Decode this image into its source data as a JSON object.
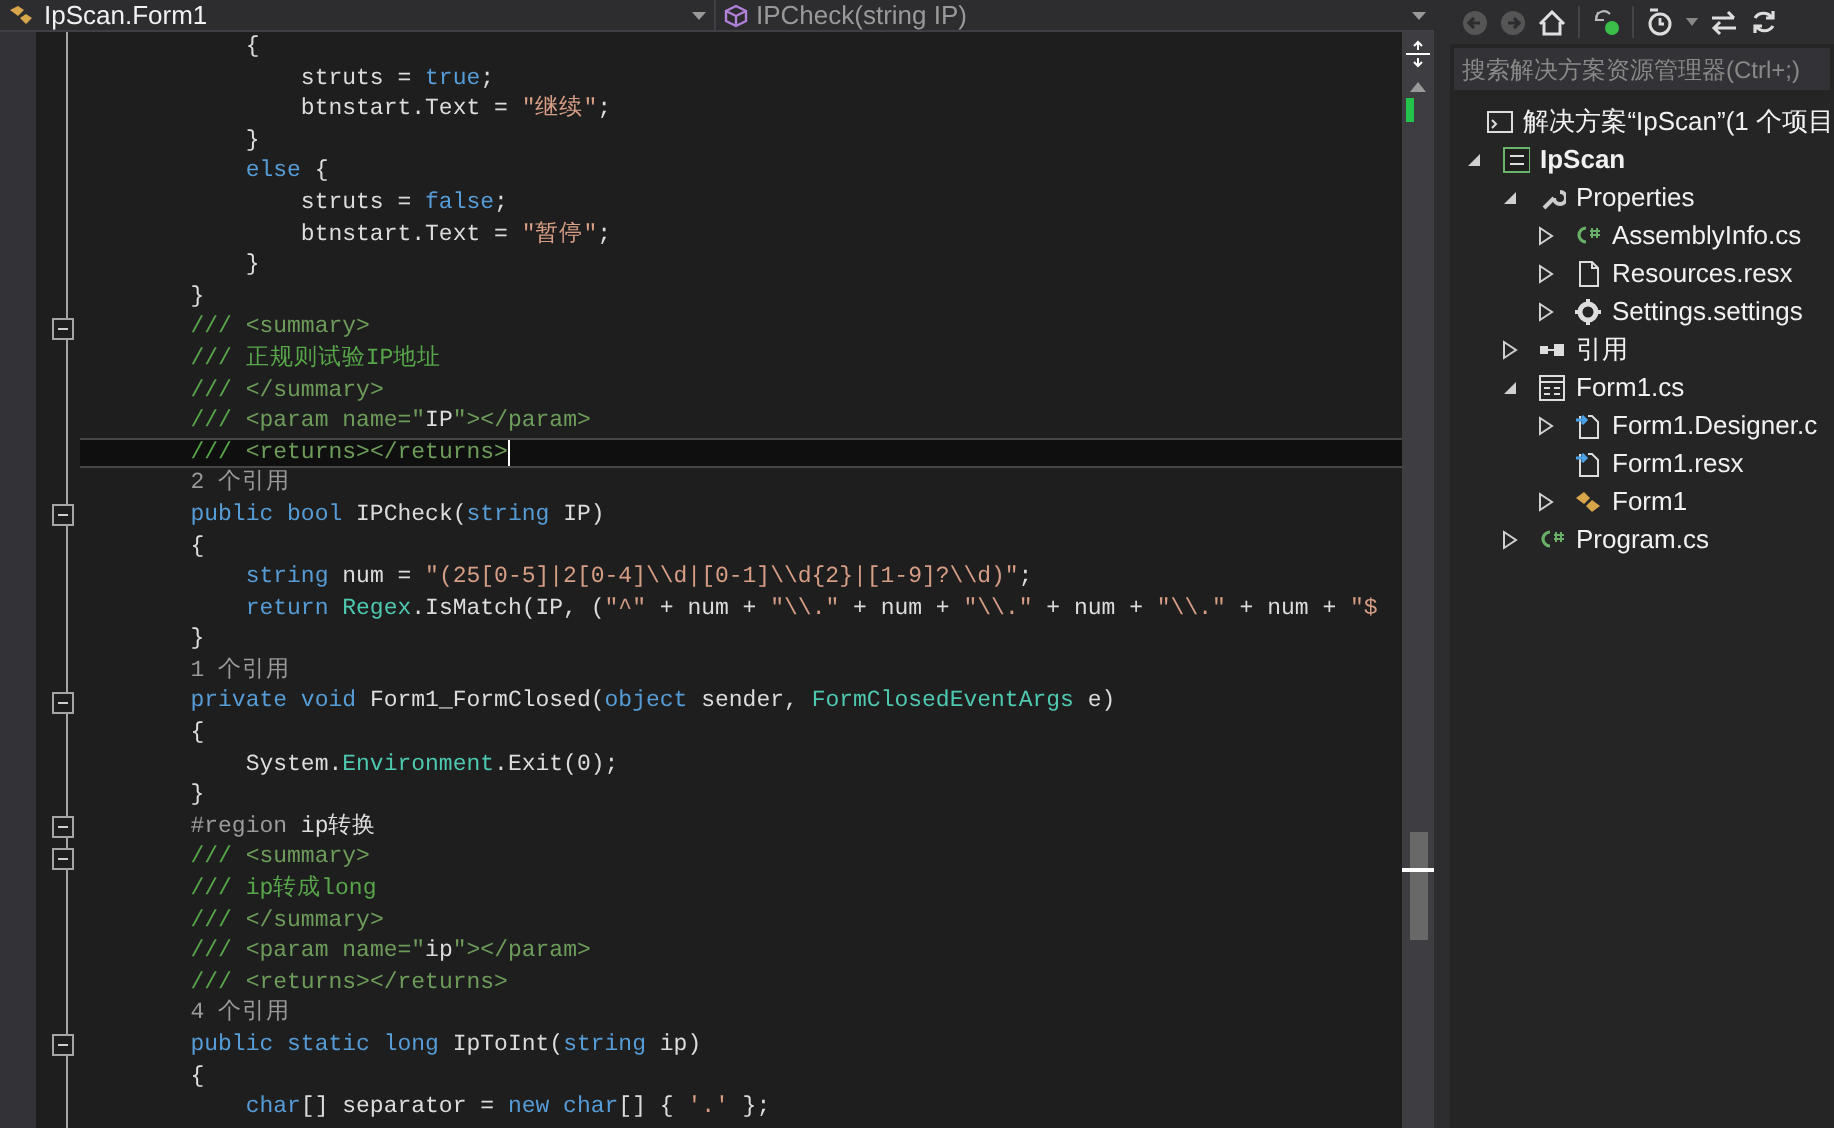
{
  "nav_bar": {
    "type_dropdown": "IpScan.Form1",
    "member_dropdown": "IPCheck(string IP)"
  },
  "code_lines": [
    {
      "fold": false,
      "current": false,
      "spans": [
        {
          "kind": "p",
          "text": "            {"
        }
      ]
    },
    {
      "fold": false,
      "current": false,
      "spans": [
        {
          "kind": "p",
          "text": "                struts = "
        },
        {
          "kind": "kw",
          "text": "true"
        },
        {
          "kind": "p",
          "text": ";"
        }
      ]
    },
    {
      "fold": false,
      "current": false,
      "spans": [
        {
          "kind": "p",
          "text": "                btnstart.Text = "
        },
        {
          "kind": "str",
          "text": "\"继续\""
        },
        {
          "kind": "p",
          "text": ";"
        }
      ]
    },
    {
      "fold": false,
      "current": false,
      "spans": [
        {
          "kind": "p",
          "text": "            }"
        }
      ]
    },
    {
      "fold": false,
      "current": false,
      "spans": [
        {
          "kind": "kw",
          "text": "            else"
        },
        {
          "kind": "p",
          "text": " {"
        }
      ]
    },
    {
      "fold": false,
      "current": false,
      "spans": [
        {
          "kind": "p",
          "text": "                struts = "
        },
        {
          "kind": "kw",
          "text": "false"
        },
        {
          "kind": "p",
          "text": ";"
        }
      ]
    },
    {
      "fold": false,
      "current": false,
      "spans": [
        {
          "kind": "p",
          "text": "                btnstart.Text = "
        },
        {
          "kind": "str",
          "text": "\"暂停\""
        },
        {
          "kind": "p",
          "text": ";"
        }
      ]
    },
    {
      "fold": false,
      "current": false,
      "spans": [
        {
          "kind": "p",
          "text": "            }"
        }
      ]
    },
    {
      "fold": false,
      "current": false,
      "spans": [
        {
          "kind": "p",
          "text": "        }"
        }
      ]
    },
    {
      "fold": true,
      "current": false,
      "spans": [
        {
          "kind": "cm",
          "text": "        /// "
        },
        {
          "kind": "doc",
          "text": "<summary>"
        }
      ]
    },
    {
      "fold": false,
      "current": false,
      "spans": [
        {
          "kind": "cm",
          "text": "        /// 正规则试验IP地址"
        }
      ]
    },
    {
      "fold": false,
      "current": false,
      "spans": [
        {
          "kind": "cm",
          "text": "        /// "
        },
        {
          "kind": "doc",
          "text": "</summary>"
        }
      ]
    },
    {
      "fold": false,
      "current": false,
      "spans": [
        {
          "kind": "cm",
          "text": "        /// "
        },
        {
          "kind": "doc",
          "text": "<param name=\""
        },
        {
          "kind": "p",
          "text": "IP"
        },
        {
          "kind": "doc",
          "text": "\"></param>"
        }
      ]
    },
    {
      "fold": false,
      "current": true,
      "spans": [
        {
          "kind": "cm",
          "text": "        /// "
        },
        {
          "kind": "doc",
          "text": "<returns></returns>"
        }
      ]
    },
    {
      "fold": false,
      "current": false,
      "spans": [
        {
          "kind": "lens",
          "text": "        2 个引用"
        }
      ]
    },
    {
      "fold": true,
      "current": false,
      "spans": [
        {
          "kind": "kw",
          "text": "        public bool "
        },
        {
          "kind": "p",
          "text": "IPCheck("
        },
        {
          "kind": "kw",
          "text": "string"
        },
        {
          "kind": "p",
          "text": " IP)"
        }
      ]
    },
    {
      "fold": false,
      "current": false,
      "spans": [
        {
          "kind": "p",
          "text": "        {"
        }
      ]
    },
    {
      "fold": false,
      "current": false,
      "spans": [
        {
          "kind": "kw",
          "text": "            string"
        },
        {
          "kind": "p",
          "text": " num = "
        },
        {
          "kind": "str",
          "text": "\"(25[0-5]|2[0-4]\\\\d|[0-1]\\\\d{2}|[1-9]?\\\\d)\""
        },
        {
          "kind": "p",
          "text": ";"
        }
      ]
    },
    {
      "fold": false,
      "current": false,
      "spans": [
        {
          "kind": "kw",
          "text": "            return "
        },
        {
          "kind": "ty",
          "text": "Regex"
        },
        {
          "kind": "p",
          "text": ".IsMatch(IP, ("
        },
        {
          "kind": "str",
          "text": "\"^\""
        },
        {
          "kind": "p",
          "text": " + num + "
        },
        {
          "kind": "str",
          "text": "\"\\\\.\""
        },
        {
          "kind": "p",
          "text": " + num + "
        },
        {
          "kind": "str",
          "text": "\"\\\\.\""
        },
        {
          "kind": "p",
          "text": " + num + "
        },
        {
          "kind": "str",
          "text": "\"\\\\.\""
        },
        {
          "kind": "p",
          "text": " + num + "
        },
        {
          "kind": "str",
          "text": "\"$"
        }
      ]
    },
    {
      "fold": false,
      "current": false,
      "spans": [
        {
          "kind": "p",
          "text": "        }"
        }
      ]
    },
    {
      "fold": false,
      "current": false,
      "spans": [
        {
          "kind": "lens",
          "text": "        1 个引用"
        }
      ]
    },
    {
      "fold": true,
      "current": false,
      "spans": [
        {
          "kind": "kw",
          "text": "        private void "
        },
        {
          "kind": "p",
          "text": "Form1_FormClosed("
        },
        {
          "kind": "kw",
          "text": "object"
        },
        {
          "kind": "p",
          "text": " sender, "
        },
        {
          "kind": "ty",
          "text": "FormClosedEventArgs"
        },
        {
          "kind": "p",
          "text": " e)"
        }
      ]
    },
    {
      "fold": false,
      "current": false,
      "spans": [
        {
          "kind": "p",
          "text": "        {"
        }
      ]
    },
    {
      "fold": false,
      "current": false,
      "spans": [
        {
          "kind": "p",
          "text": "            System."
        },
        {
          "kind": "ty",
          "text": "Environment"
        },
        {
          "kind": "p",
          "text": ".Exit(0);"
        }
      ]
    },
    {
      "fold": false,
      "current": false,
      "spans": [
        {
          "kind": "p",
          "text": "        }"
        }
      ]
    },
    {
      "fold": true,
      "current": false,
      "spans": [
        {
          "kind": "pre",
          "text": "        #region "
        },
        {
          "kind": "p",
          "text": "ip转换"
        }
      ]
    },
    {
      "fold": true,
      "current": false,
      "spans": [
        {
          "kind": "cm",
          "text": "        /// "
        },
        {
          "kind": "doc",
          "text": "<summary>"
        }
      ]
    },
    {
      "fold": false,
      "current": false,
      "spans": [
        {
          "kind": "cm",
          "text": "        /// ip转成long"
        }
      ]
    },
    {
      "fold": false,
      "current": false,
      "spans": [
        {
          "kind": "cm",
          "text": "        /// "
        },
        {
          "kind": "doc",
          "text": "</summary>"
        }
      ]
    },
    {
      "fold": false,
      "current": false,
      "spans": [
        {
          "kind": "cm",
          "text": "        /// "
        },
        {
          "kind": "doc",
          "text": "<param name=\""
        },
        {
          "kind": "p",
          "text": "ip"
        },
        {
          "kind": "doc",
          "text": "\"></param>"
        }
      ]
    },
    {
      "fold": false,
      "current": false,
      "spans": [
        {
          "kind": "cm",
          "text": "        /// "
        },
        {
          "kind": "doc",
          "text": "<returns></returns>"
        }
      ]
    },
    {
      "fold": false,
      "current": false,
      "spans": [
        {
          "kind": "lens",
          "text": "        4 个引用"
        }
      ]
    },
    {
      "fold": true,
      "current": false,
      "spans": [
        {
          "kind": "kw",
          "text": "        public static long "
        },
        {
          "kind": "p",
          "text": "IpToInt("
        },
        {
          "kind": "kw",
          "text": "string"
        },
        {
          "kind": "p",
          "text": " ip)"
        }
      ]
    },
    {
      "fold": false,
      "current": false,
      "spans": [
        {
          "kind": "p",
          "text": "        {"
        }
      ]
    },
    {
      "fold": false,
      "current": false,
      "spans": [
        {
          "kind": "kw",
          "text": "            char"
        },
        {
          "kind": "p",
          "text": "[] separator = "
        },
        {
          "kind": "kw",
          "text": "new char"
        },
        {
          "kind": "p",
          "text": "[] { "
        },
        {
          "kind": "str",
          "text": "'.'"
        },
        {
          "kind": "p",
          "text": " };"
        }
      ]
    }
  ],
  "solution_explorer": {
    "search": {
      "placeholder": "搜索解决方案资源管理器(Ctrl+;)"
    },
    "tree": [
      {
        "label": "解决方案“IpScan”(1 个项目",
        "kind": "solution",
        "startup": false
      },
      {
        "label": "IpScan",
        "kind": "project",
        "expanded": true,
        "startup": true,
        "children": [
          {
            "label": "Properties",
            "kind": "wrench",
            "expanded": true,
            "startup": false,
            "children": [
              {
                "label": "AssemblyInfo.cs",
                "kind": "cs",
                "expanded": false,
                "startup": false
              },
              {
                "label": "Resources.resx",
                "kind": "resx",
                "expanded": false,
                "startup": false
              },
              {
                "label": "Settings.settings",
                "kind": "gear",
                "expanded": false,
                "startup": false
              }
            ]
          },
          {
            "label": "引用",
            "kind": "refs",
            "expanded": false,
            "startup": false
          },
          {
            "label": "Form1.cs",
            "kind": "form",
            "expanded": true,
            "startup": false,
            "children": [
              {
                "label": "Form1.Designer.c",
                "kind": "designer",
                "expanded": false,
                "startup": false
              },
              {
                "label": "Form1.resx",
                "kind": "designer",
                "startup": false
              },
              {
                "label": "Form1",
                "kind": "class",
                "expanded": false,
                "startup": false
              }
            ]
          },
          {
            "label": "Program.cs",
            "kind": "cs",
            "expanded": false,
            "startup": false
          }
        ]
      }
    ]
  }
}
